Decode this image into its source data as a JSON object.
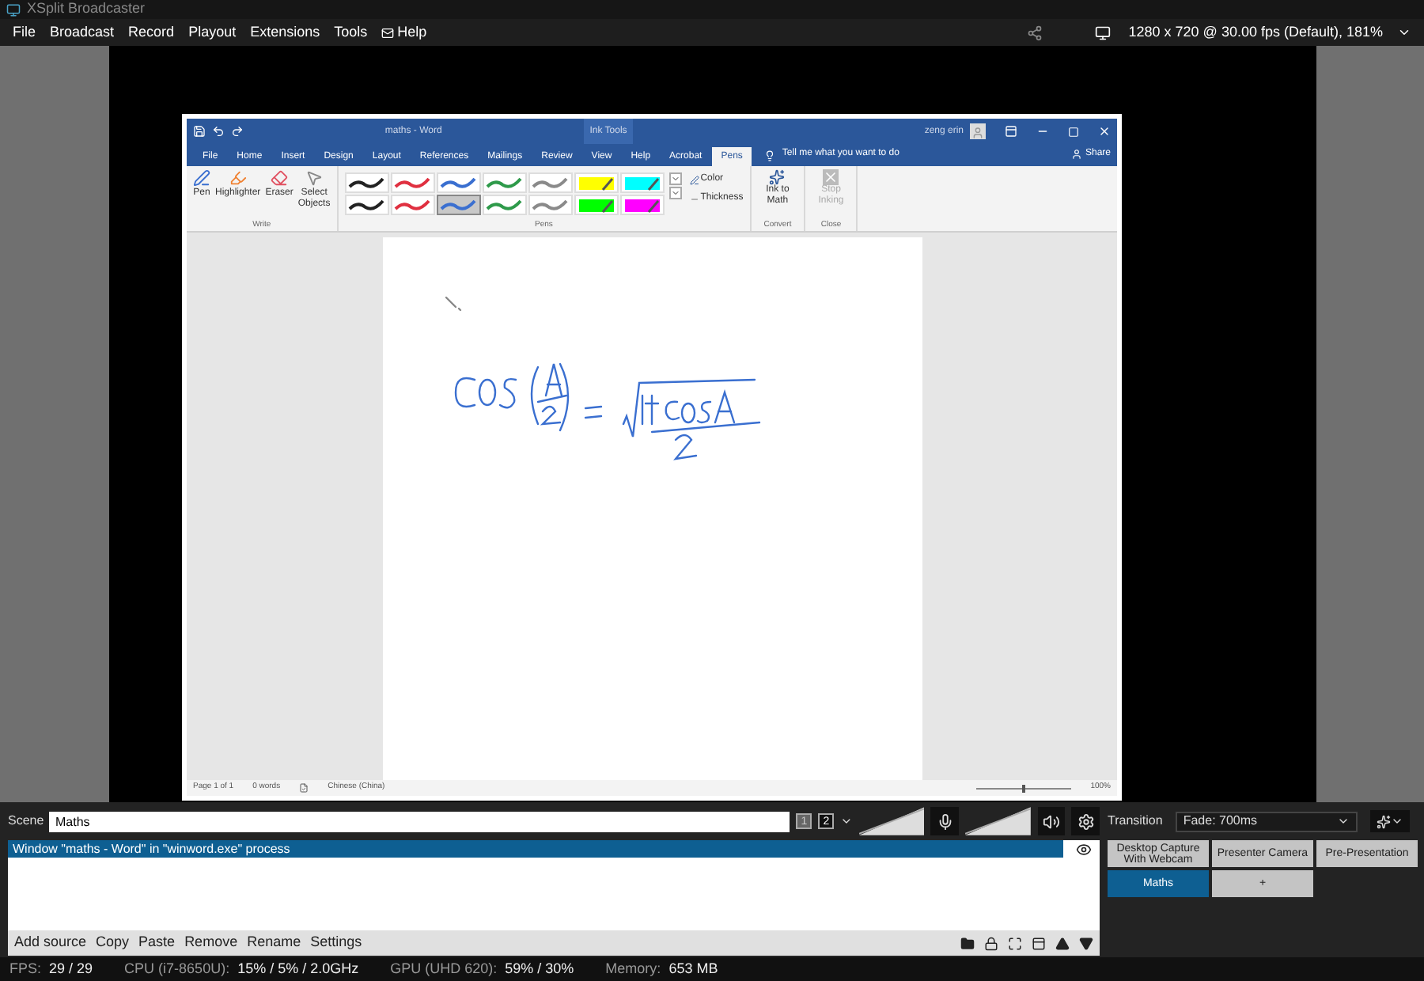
{
  "window": {
    "title": "XSplit Broadcaster"
  },
  "menu": [
    "File",
    "Broadcast",
    "Record",
    "Playout",
    "Extensions",
    "Tools",
    "Help"
  ],
  "resolution": "1280 x 720 @ 30.00 fps (Default), 181%",
  "word": {
    "title": "maths - Word",
    "context_tab": "Ink Tools",
    "user": "zeng erin",
    "tabs": [
      {
        "label": "File",
        "selected": false
      },
      {
        "label": "Home",
        "selected": false
      },
      {
        "label": "Insert",
        "selected": false
      },
      {
        "label": "Design",
        "selected": false
      },
      {
        "label": "Layout",
        "selected": false
      },
      {
        "label": "References",
        "selected": false
      },
      {
        "label": "Mailings",
        "selected": false
      },
      {
        "label": "Review",
        "selected": false
      },
      {
        "label": "View",
        "selected": false
      },
      {
        "label": "Help",
        "selected": false
      },
      {
        "label": "Acrobat",
        "selected": false
      },
      {
        "label": "Pens",
        "selected": true
      }
    ],
    "tell_me": "Tell me what you want to do",
    "share": "Share",
    "write_tools": [
      {
        "kind": "pen",
        "label": "Pen"
      },
      {
        "kind": "highlighter",
        "label": "Highlighter"
      },
      {
        "kind": "eraser",
        "label": "Eraser"
      },
      {
        "kind": "select",
        "label": "Select\nObjects"
      }
    ],
    "write_group": "Write",
    "pens": [
      {
        "kind": "pen",
        "color": "#222222",
        "selected": false
      },
      {
        "kind": "pen",
        "color": "#e03040",
        "selected": false
      },
      {
        "kind": "pen",
        "color": "#3a6fd0",
        "selected": false
      },
      {
        "kind": "pen",
        "color": "#2e9a4a",
        "selected": false
      },
      {
        "kind": "pen",
        "color": "#8a8a8a",
        "selected": false
      },
      {
        "kind": "highlighter",
        "color": "#ffff00",
        "selected": false
      },
      {
        "kind": "highlighter",
        "color": "#00ffff",
        "selected": false
      },
      {
        "kind": "pen",
        "color": "#222222",
        "selected": false
      },
      {
        "kind": "pen",
        "color": "#e03040",
        "selected": false
      },
      {
        "kind": "pen",
        "color": "#3a6fd0",
        "selected": true
      },
      {
        "kind": "pen",
        "color": "#2e9a4a",
        "selected": false
      },
      {
        "kind": "pen",
        "color": "#8a8a8a",
        "selected": false
      },
      {
        "kind": "highlighter",
        "color": "#00ff00",
        "selected": false
      },
      {
        "kind": "highlighter",
        "color": "#ff00ff",
        "selected": false
      }
    ],
    "color_label": "Color",
    "thickness_label": "Thickness",
    "pens_group": "Pens",
    "ink_to_math": "Ink to\nMath",
    "convert_group": "Convert",
    "stop_inking": {
      "label": "Stop\nInking",
      "disabled": true
    },
    "close_group": "Close",
    "status": {
      "page": "Page 1 of 1",
      "words": "0 words",
      "language": "Chinese (China)",
      "zoom": "100%",
      "zoom_slider": {
        "level": 0.5
      }
    }
  },
  "scene": {
    "label": "Scene",
    "value": "Maths",
    "views": [
      {
        "label": "1",
        "selected": false
      },
      {
        "label": "2",
        "selected": true
      }
    ]
  },
  "transition": {
    "label": "Transition",
    "value": "Fade: 700ms"
  },
  "sources": [
    {
      "label": "Window \"maths - Word\" in \"winword.exe\" process",
      "selected": true
    }
  ],
  "source_actions": [
    "Add source",
    "Copy",
    "Paste",
    "Remove",
    "Rename",
    "Settings"
  ],
  "scenes": [
    {
      "label": "Desktop Capture\nWith Webcam",
      "selected": false
    },
    {
      "label": "Presenter Camera",
      "selected": false
    },
    {
      "label": "Pre-Presentation",
      "selected": false
    },
    {
      "label": "Maths",
      "selected": true
    },
    {
      "label": "+",
      "selected": false
    }
  ],
  "stats": [
    {
      "label": "FPS:",
      "value": "29 / 29"
    },
    {
      "label": "CPU (i7-8650U):",
      "value": "15% / 5% / 2.0GHz"
    },
    {
      "label": "GPU (UHD 620):",
      "value": "59% / 30%"
    },
    {
      "label": "Memory:",
      "value": "653 MB"
    }
  ]
}
